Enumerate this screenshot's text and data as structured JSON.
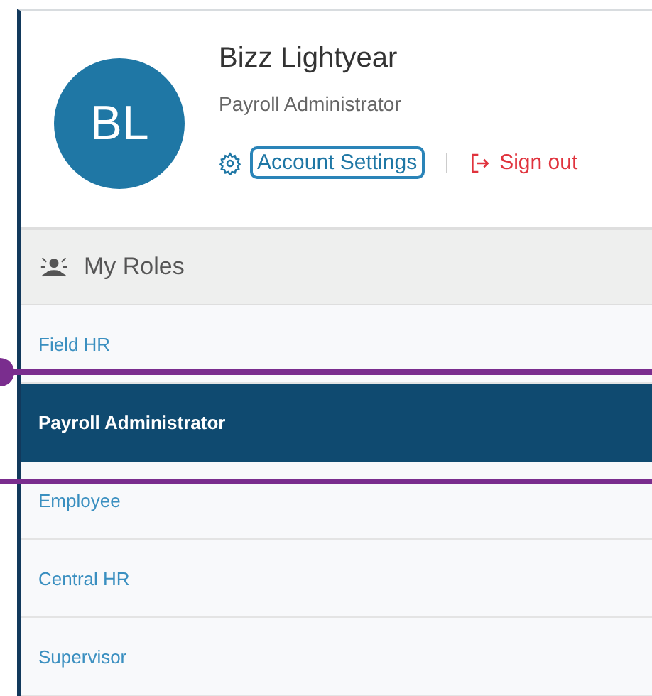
{
  "profile": {
    "initials": "BL",
    "name": "Bizz Lightyear",
    "role": "Payroll Administrator"
  },
  "actions": {
    "settings": "Account Settings",
    "sign_out": "Sign out"
  },
  "roles_header": "My Roles",
  "roles": [
    {
      "label": "Field HR",
      "selected": false
    },
    {
      "label": "Payroll Administrator",
      "selected": true
    },
    {
      "label": "Employee",
      "selected": false
    },
    {
      "label": "Central HR",
      "selected": false
    },
    {
      "label": "Supervisor",
      "selected": false
    }
  ]
}
